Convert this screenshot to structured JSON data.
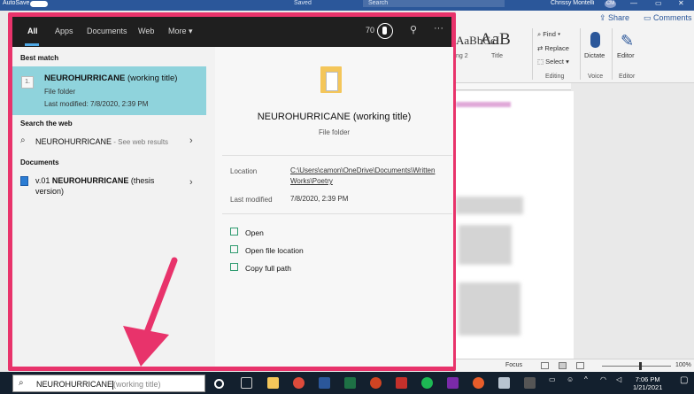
{
  "word": {
    "autosave_label": "AutoSave",
    "saved_label": "Saved",
    "search_placeholder": "Search",
    "user_name": "Chrissy Montelli",
    "user_initials": "CM",
    "share_label": "Share",
    "comments_label": "Comments",
    "style_a": "AaBbCcI",
    "style_a_label": "ng 2",
    "style_b": "AaB",
    "style_b_label": "Title",
    "find_label": "Find",
    "replace_label": "Replace",
    "select_label": "Select",
    "editing_label": "Editing",
    "dictate_label": "Dictate",
    "voice_label": "Voice",
    "editor_label": "Editor",
    "editor_group_label": "Editor",
    "focus_label": "Focus",
    "zoom_label": "100%"
  },
  "search": {
    "tabs": [
      {
        "label": "All",
        "active": true
      },
      {
        "label": "Apps",
        "active": false
      },
      {
        "label": "Documents",
        "active": false
      },
      {
        "label": "Web",
        "active": false
      },
      {
        "label": "More",
        "active": false
      }
    ],
    "rewards_points": "70",
    "best_match_label": "Best match",
    "best_match": {
      "title_bold": "NEUROHURRICANE",
      "title_rest": " (working title)",
      "type": "File folder",
      "modified": "Last modified: 7/8/2020, 2:39 PM"
    },
    "search_web_label": "Search the web",
    "web_result": {
      "query": "NEUROHURRICANE",
      "suffix": " - See web results"
    },
    "documents_label": "Documents",
    "document_result": {
      "prefix": "v.01 ",
      "bold": "NEUROHURRICANE",
      "rest_line1": " (thesis",
      "rest_line2": "version)"
    },
    "detail": {
      "title": "NEUROHURRICANE (working title)",
      "type": "File folder",
      "location_label": "Location",
      "location_value": "C:\\Users\\camon\\OneDrive\\Documents\\Written Works\\Poetry",
      "modified_label": "Last modified",
      "modified_value": "7/8/2020, 2:39 PM",
      "actions": [
        "Open",
        "Open file location",
        "Copy full path"
      ]
    }
  },
  "taskbar": {
    "search_query": "NEUROHURRICANE",
    "search_hint": "(working title)",
    "time": "7:06 PM",
    "date": "1/21/2021"
  },
  "colors": {
    "highlight_border": "#e8336b",
    "best_match_bg": "#8fd3dc",
    "word_blue": "#2b579a",
    "taskbar_bg": "#13202e"
  }
}
